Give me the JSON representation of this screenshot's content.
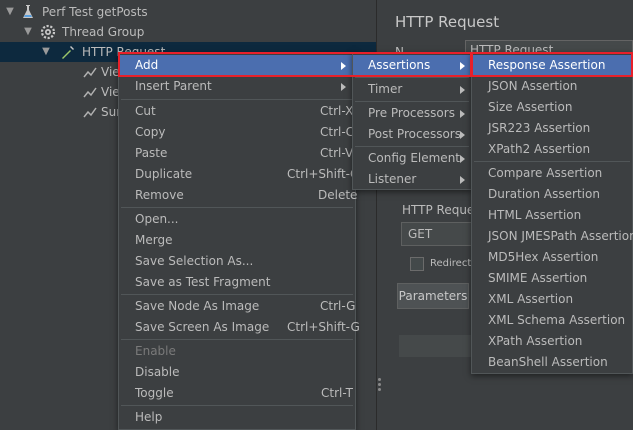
{
  "tree": {
    "items": [
      {
        "label": "Perf Test getPosts"
      },
      {
        "label": "Thread Group"
      },
      {
        "label": "HTTP Request"
      },
      {
        "label": "Vie"
      },
      {
        "label": "Vie"
      },
      {
        "label": "Sur"
      }
    ]
  },
  "right_panel": {
    "title": "HTTP Request",
    "name_label": "N",
    "name_value": "HTTP Request",
    "request_label": "HTTP Reques",
    "method": "GET",
    "redirect_label": "Redirect A",
    "params_tab": "Parameters"
  },
  "context_menu": {
    "items": [
      {
        "label": "Add",
        "shortcut": "",
        "submenu": true
      },
      {
        "label": "Insert Parent",
        "shortcut": "",
        "submenu": true
      },
      {
        "label": "Cut",
        "shortcut": "Ctrl-X"
      },
      {
        "label": "Copy",
        "shortcut": "Ctrl-C"
      },
      {
        "label": "Paste",
        "shortcut": "Ctrl-V"
      },
      {
        "label": "Duplicate",
        "shortcut": "Ctrl+Shift-C"
      },
      {
        "label": "Remove",
        "shortcut": "Delete"
      },
      {
        "label": "Open..."
      },
      {
        "label": "Merge"
      },
      {
        "label": "Save Selection As..."
      },
      {
        "label": "Save as Test Fragment"
      },
      {
        "label": "Save Node As Image",
        "shortcut": "Ctrl-G"
      },
      {
        "label": "Save Screen As Image",
        "shortcut": "Ctrl+Shift-G"
      },
      {
        "label": "Enable"
      },
      {
        "label": "Disable"
      },
      {
        "label": "Toggle",
        "shortcut": "Ctrl-T"
      },
      {
        "label": "Help"
      }
    ]
  },
  "add_submenu": {
    "items": [
      {
        "label": "Assertions"
      },
      {
        "label": "Timer"
      },
      {
        "label": "Pre Processors"
      },
      {
        "label": "Post Processors"
      },
      {
        "label": "Config Element"
      },
      {
        "label": "Listener"
      }
    ]
  },
  "assertions_submenu": {
    "items": [
      {
        "label": "Response Assertion"
      },
      {
        "label": "JSON Assertion"
      },
      {
        "label": "Size Assertion"
      },
      {
        "label": "JSR223 Assertion"
      },
      {
        "label": "XPath2 Assertion"
      },
      {
        "label": "Compare Assertion"
      },
      {
        "label": "Duration Assertion"
      },
      {
        "label": "HTML Assertion"
      },
      {
        "label": "JSON JMESPath Assertion"
      },
      {
        "label": "MD5Hex Assertion"
      },
      {
        "label": "SMIME Assertion"
      },
      {
        "label": "XML Assertion"
      },
      {
        "label": "XML Schema Assertion"
      },
      {
        "label": "XPath Assertion"
      },
      {
        "label": "BeanShell Assertion"
      }
    ]
  },
  "colors": {
    "highlight": "#4b6eaf",
    "callout": "#e8202a",
    "background": "#3c3f41"
  }
}
